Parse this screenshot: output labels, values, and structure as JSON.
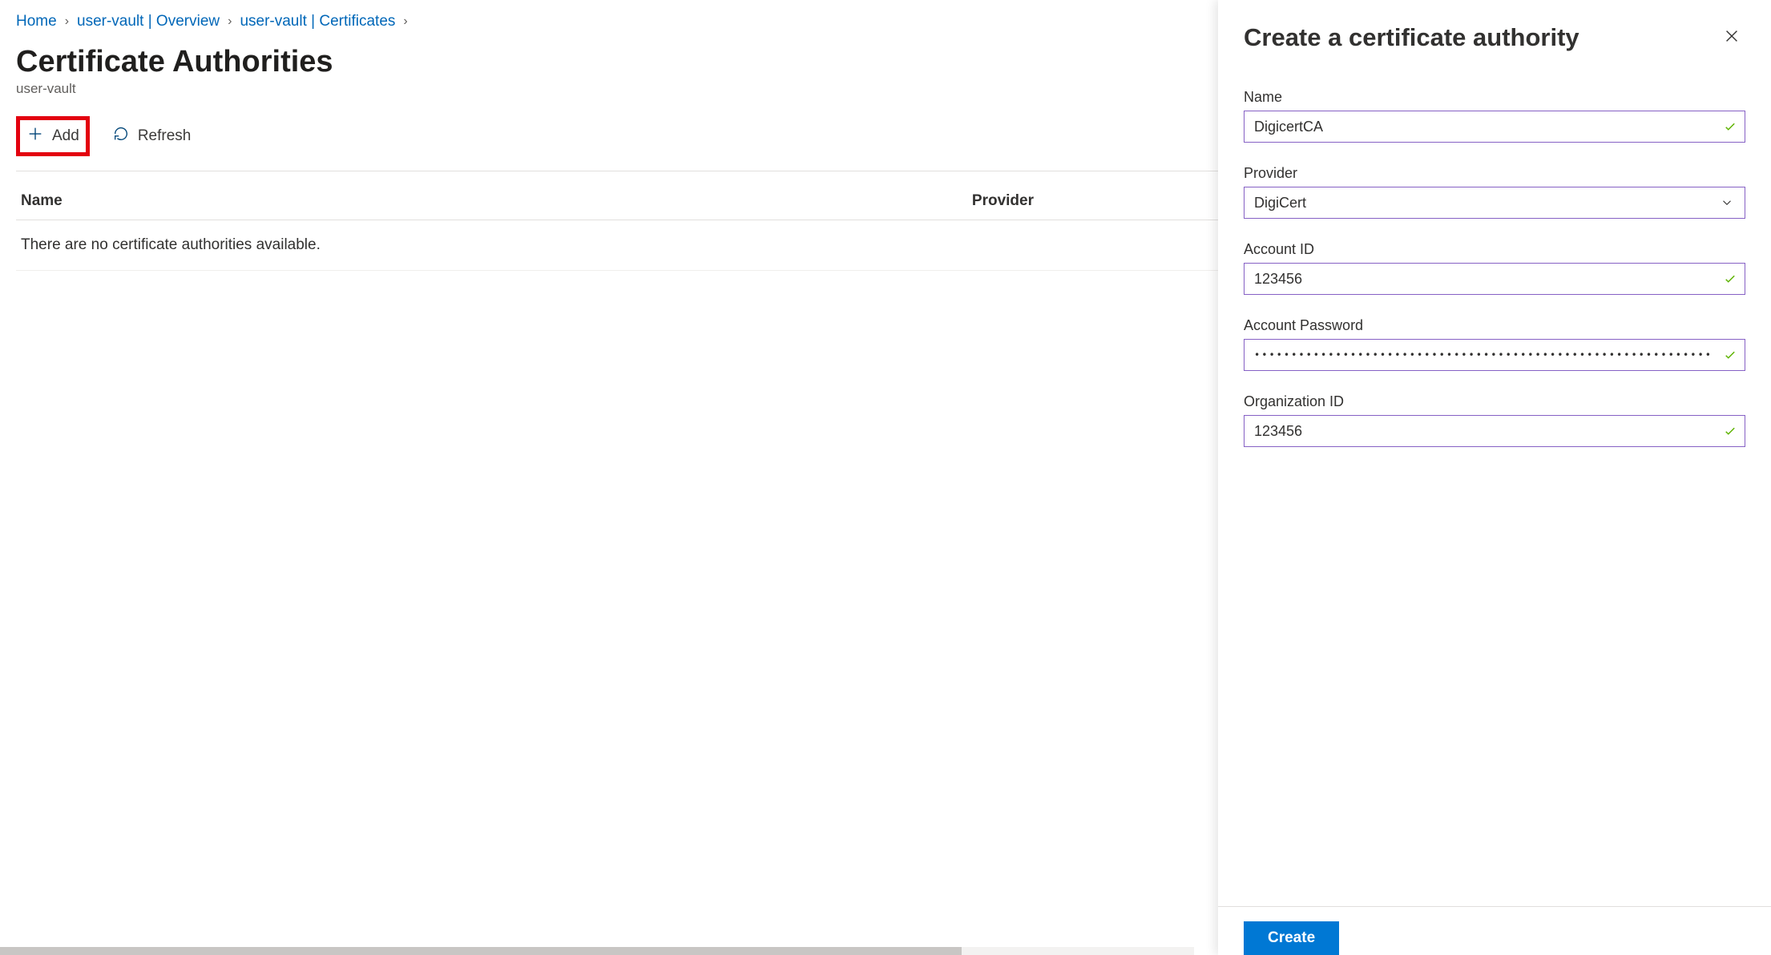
{
  "breadcrumb": {
    "items": [
      {
        "label": "Home"
      },
      {
        "label": "user-vault | Overview"
      },
      {
        "label": "user-vault | Certificates"
      }
    ]
  },
  "page": {
    "title": "Certificate Authorities",
    "subtitle": "user-vault"
  },
  "toolbar": {
    "add_label": "Add",
    "refresh_label": "Refresh"
  },
  "table": {
    "col_name": "Name",
    "col_provider": "Provider",
    "empty_message": "There are no certificate authorities available."
  },
  "panel": {
    "title": "Create a certificate authority",
    "fields": {
      "name": {
        "label": "Name",
        "value": "DigicertCA"
      },
      "provider": {
        "label": "Provider",
        "value": "DigiCert"
      },
      "account_id": {
        "label": "Account ID",
        "value": "123456"
      },
      "password": {
        "label": "Account Password",
        "value": "••••••••••••••••••••••••••••••••••••••••••••••••••••••••••••••••••••••••••••••••••"
      },
      "org_id": {
        "label": "Organization ID",
        "value": "123456"
      }
    },
    "create_label": "Create"
  }
}
